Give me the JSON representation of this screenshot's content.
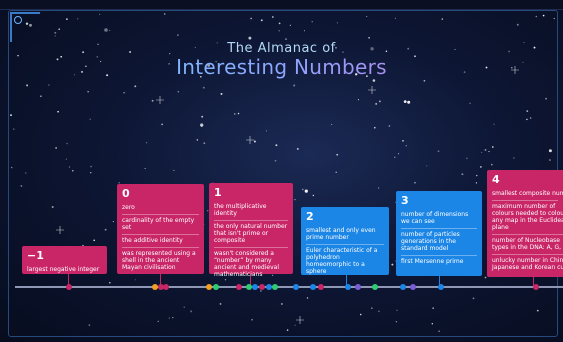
{
  "title": {
    "line1": "The Almanac of",
    "line2": "Interesting Numbers"
  },
  "colors": {
    "pink": "#c92668",
    "blue": "#1c86e6",
    "axis": "#8e97b3"
  },
  "cards": [
    {
      "number": "−1",
      "facts": [
        "largest negative integer"
      ]
    },
    {
      "number": "0",
      "facts": [
        "zero",
        "cardinality of the empty set",
        "the additive identity",
        "was represented using a shell in the ancient Mayan civilisation"
      ]
    },
    {
      "number": "1",
      "facts": [
        "the multiplicative identity",
        "the only natural number that isn't prime or composite",
        "wasn't considered a “number” by many ancient and medieval mathematicians"
      ]
    },
    {
      "number": "2",
      "facts": [
        "smallest and only even prime number",
        "Euler characteristic of a polyhedron homeomorphic to a sphere"
      ]
    },
    {
      "number": "3",
      "facts": [
        "number of dimensions we can see",
        "number of particles generations in the standard model",
        "first Mersenne prime"
      ]
    },
    {
      "number": "4",
      "facts": [
        "smallest composite number",
        "maximum number of colours needed to colour any map in the Euclidean plane",
        "number of Nucleobase types in the DNA: A, G, C, T",
        "unlucky number in Chinese, Japanese and Korean culture"
      ]
    }
  ],
  "timeline_dot_colors": [
    "#c92668",
    "#c92668",
    "#f0a020",
    "#c92668",
    "#f0a020",
    "#2ecc71",
    "#c92668",
    "#2ecc71",
    "#1c86e6",
    "#c92668",
    "#1c86e6",
    "#2ecc71",
    "#1c86e6",
    "#1c86e6",
    "#c92668",
    "#1c86e6",
    "#7a5cd6",
    "#2ecc71",
    "#1c86e6",
    "#7a5cd6",
    "#1c86e6",
    "#c92668"
  ]
}
